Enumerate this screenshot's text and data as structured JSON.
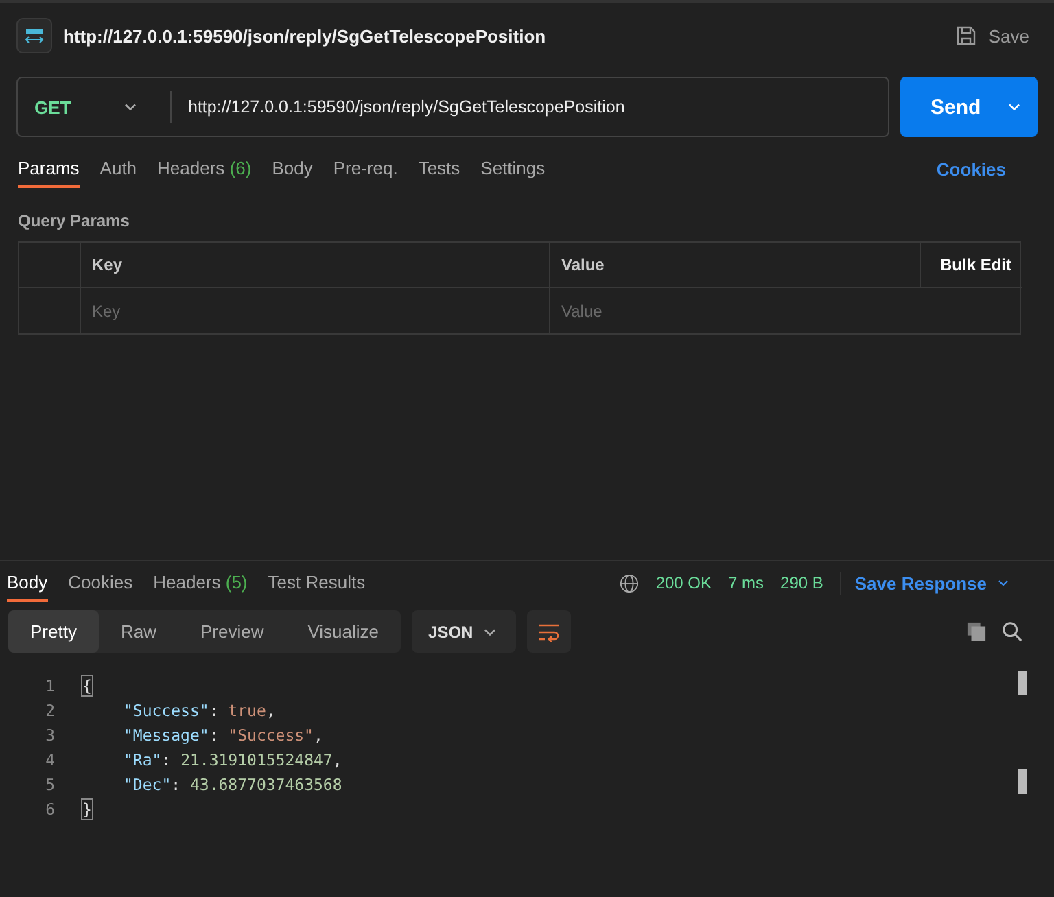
{
  "header": {
    "title": "http://127.0.0.1:59590/json/reply/SgGetTelescopePosition",
    "save": "Save"
  },
  "request": {
    "method": "GET",
    "url": "http://127.0.0.1:59590/json/reply/SgGetTelescopePosition",
    "send": "Send"
  },
  "request_tabs": [
    {
      "label": "Params",
      "selected": true
    },
    {
      "label": "Auth",
      "selected": false
    },
    {
      "label": "Headers",
      "count": "(6)",
      "selected": false
    },
    {
      "label": "Body",
      "selected": false
    },
    {
      "label": "Pre-req.",
      "selected": false
    },
    {
      "label": "Tests",
      "selected": false
    },
    {
      "label": "Settings",
      "selected": false
    }
  ],
  "cookies_link": "Cookies",
  "query_params": {
    "title": "Query Params",
    "columns": [
      "Key",
      "Value"
    ],
    "bulk_edit": "Bulk Edit",
    "placeholders": [
      "Key",
      "Value"
    ]
  },
  "response_tabs": [
    {
      "label": "Body",
      "selected": true
    },
    {
      "label": "Cookies",
      "selected": false
    },
    {
      "label": "Headers",
      "count": "(5)",
      "selected": false
    },
    {
      "label": "Test Results",
      "selected": false
    }
  ],
  "status": {
    "code": "200 OK",
    "time": "7 ms",
    "size": "290 B",
    "save_response": "Save Response"
  },
  "view_modes": [
    {
      "label": "Pretty",
      "selected": true
    },
    {
      "label": "Raw",
      "selected": false
    },
    {
      "label": "Preview",
      "selected": false
    },
    {
      "label": "Visualize",
      "selected": false
    }
  ],
  "format": "JSON",
  "code_lines": [
    {
      "number": "1",
      "tokens": [
        {
          "kind": "bracket",
          "text": "{"
        }
      ]
    },
    {
      "number": "2",
      "tokens": [
        {
          "kind": "key",
          "text": "\"Success\""
        },
        {
          "kind": "punct",
          "text": ": "
        },
        {
          "kind": "bool",
          "text": "true"
        },
        {
          "kind": "punct",
          "text": ","
        }
      ]
    },
    {
      "number": "3",
      "tokens": [
        {
          "kind": "key",
          "text": "\"Message\""
        },
        {
          "kind": "punct",
          "text": ": "
        },
        {
          "kind": "string",
          "text": "\"Success\""
        },
        {
          "kind": "punct",
          "text": ","
        }
      ]
    },
    {
      "number": "4",
      "tokens": [
        {
          "kind": "key",
          "text": "\"Ra\""
        },
        {
          "kind": "punct",
          "text": ": "
        },
        {
          "kind": "number",
          "text": "21.3191015524847"
        },
        {
          "kind": "punct",
          "text": ","
        }
      ]
    },
    {
      "number": "5",
      "tokens": [
        {
          "kind": "key",
          "text": "\"Dec\""
        },
        {
          "kind": "punct",
          "text": ": "
        },
        {
          "kind": "number",
          "text": "43.6877037463568"
        }
      ]
    },
    {
      "number": "6",
      "tokens": [
        {
          "kind": "bracket",
          "text": "}"
        }
      ]
    }
  ]
}
